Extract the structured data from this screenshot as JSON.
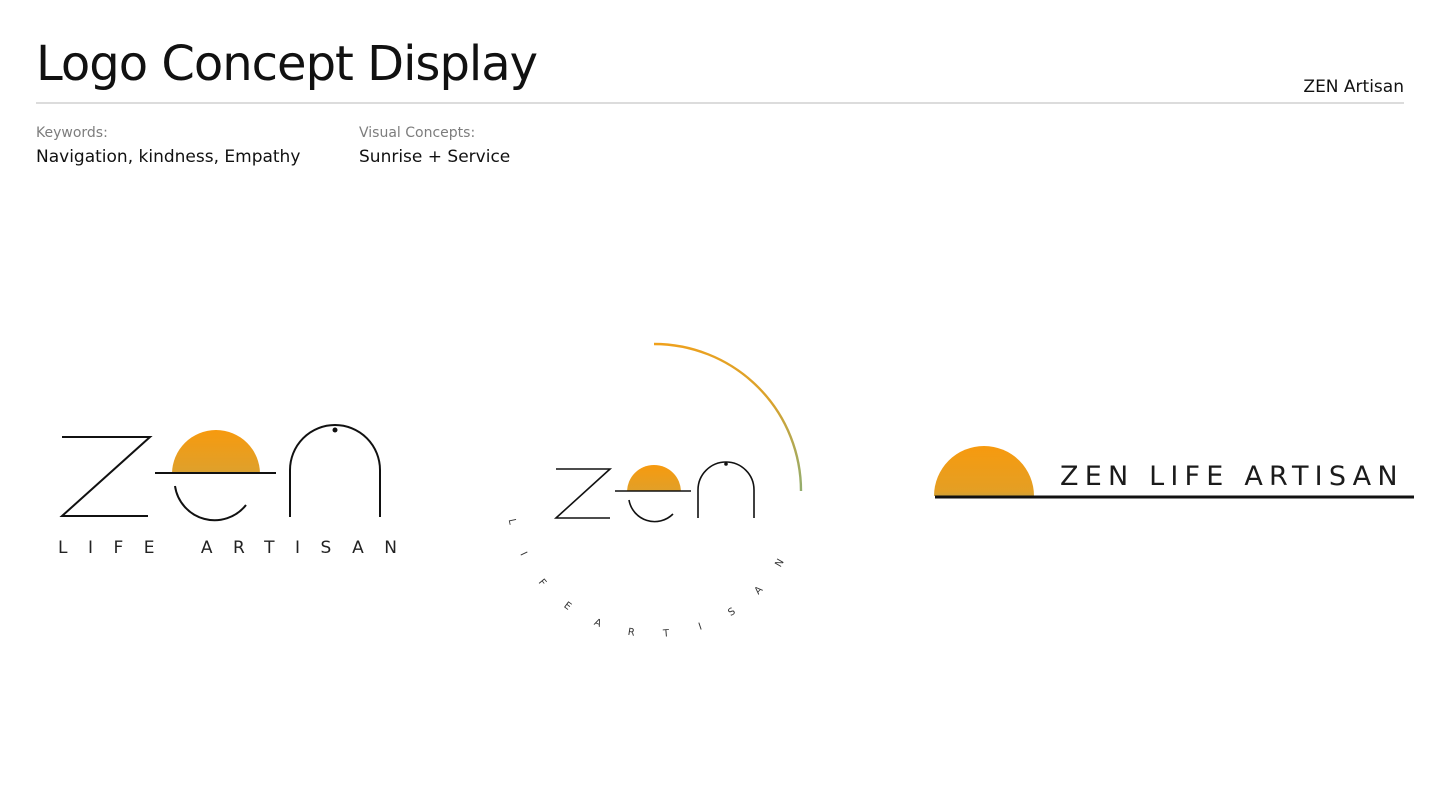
{
  "header": {
    "title": "Logo Concept Display",
    "brand": "ZEN Artisan"
  },
  "meta": {
    "keywords": {
      "label": "Keywords:",
      "value": "Navigation, kindness, Empathy"
    },
    "concepts": {
      "label": "Visual Concepts:",
      "value": "Sunrise + Service"
    }
  },
  "logos": {
    "primary": {
      "subline": "LIFE ARTISAN"
    },
    "circular": {
      "arc_letters": [
        "L",
        "I",
        "F",
        "E",
        "A",
        "R",
        "T",
        "I",
        "S",
        "A",
        "N"
      ]
    },
    "horizontal": {
      "wordmark": "ZEN LIFE ARTISAN"
    }
  },
  "colors": {
    "sun_top": "#f79a0e",
    "sun_bottom": "#0fb3ef",
    "arc_start": "#f0a11c",
    "arc_end": "#93ad6e",
    "ink": "#111111"
  }
}
